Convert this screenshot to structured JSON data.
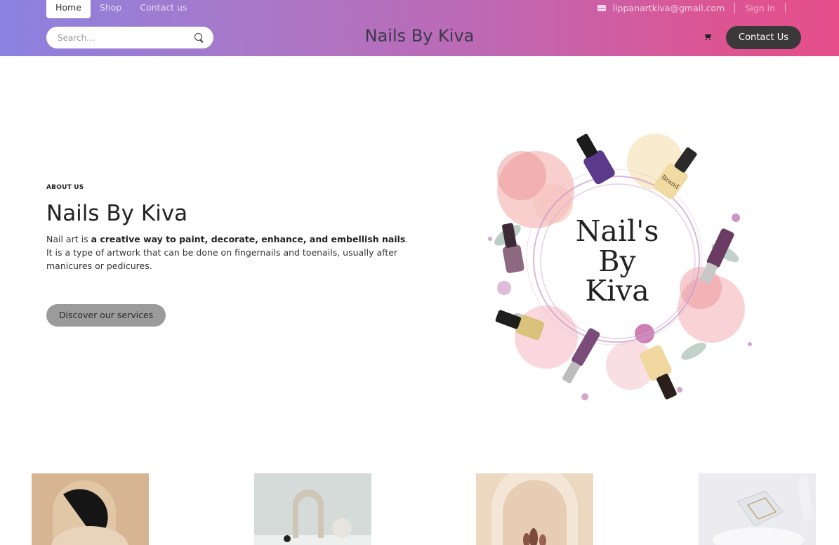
{
  "header": {
    "nav": [
      {
        "label": "Home",
        "active": true
      },
      {
        "label": "Shop",
        "active": false
      },
      {
        "label": "Contact us",
        "active": false
      }
    ],
    "email": "lippanartkiva@gmail.com",
    "sign_in": "Sign in",
    "search_placeholder": "Search...",
    "brand": "Nails By Kiva",
    "contact_button": "Contact Us",
    "icons": [
      "envelope-icon",
      "search-icon",
      "cart-icon"
    ],
    "gradient_colors": [
      "#8b82e0",
      "#c067b2",
      "#e54d8a"
    ]
  },
  "about": {
    "eyebrow": "ABOUT US",
    "title": "Nails By Kiva",
    "text_start": "Nail art is ",
    "text_bold": "a creative way to paint, decorate, enhance, and embellish nails",
    "text_end": ". It is a type of artwork that can be done on fingernails and toenails, usually after manicures or pedicures.",
    "button": "Discover our services"
  },
  "logo": {
    "line1": "Nail's",
    "line2": "By",
    "line3": "Kiva",
    "bottle_label": "Brand"
  }
}
